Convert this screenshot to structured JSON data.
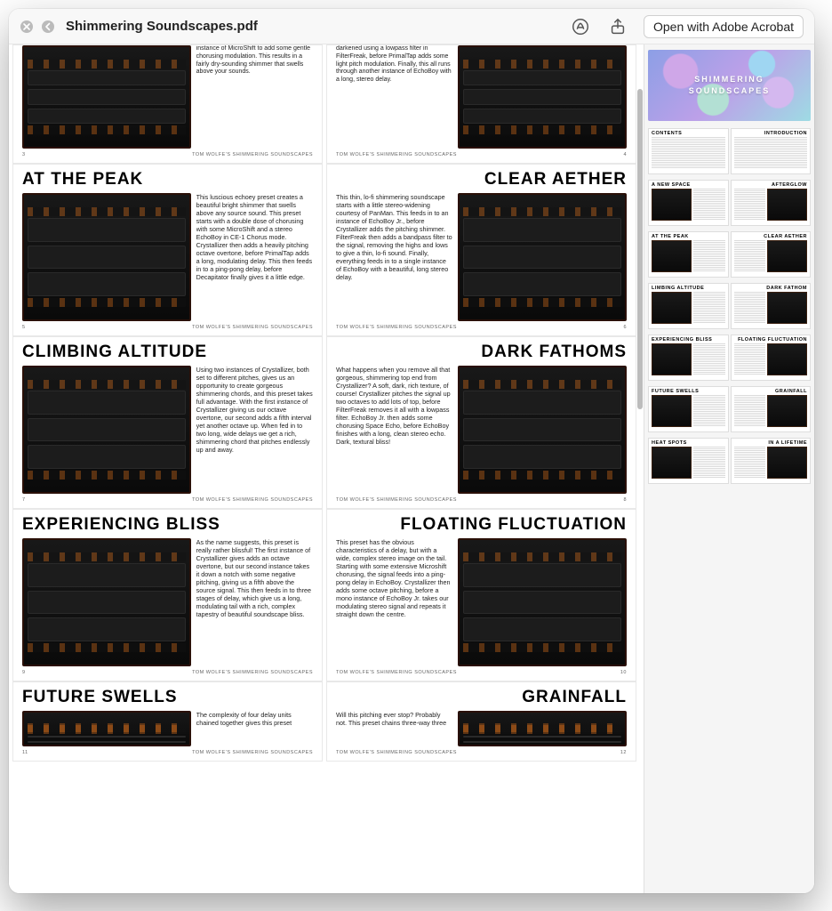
{
  "window": {
    "title": "Shimmering Soundscapes.pdf",
    "open_button": "Open with Adobe Acrobat"
  },
  "cover": {
    "line1": "SHIMMERING",
    "line2": "SOUNDSCAPES"
  },
  "footer_text": "TOM WOLFE'S SHIMMERING SOUNDSCAPES",
  "main_spreads": [
    {
      "left": {
        "page_no": "3",
        "title": "",
        "body": "instance of MicroShift to add some gentle chorusing modulation. This results in a fairly dry-sounding shimmer that swells above your sounds."
      },
      "right": {
        "page_no": "4",
        "title": "",
        "body": "darkened using a lowpass filter in FilterFreak, before PrimalTap adds some light pitch modulation. Finally, this all runs through another instance of EchoBoy with a long, stereo delay."
      }
    },
    {
      "left": {
        "page_no": "5",
        "title": "AT THE PEAK",
        "body": "This luscious echoey preset creates a beautiful bright shimmer that swells above any source sound. This preset starts with a double dose of chorusing with some MicroShift and a stereo EchoBoy in CE-1 Chorus mode. Crystallizer then adds a heavily pitching octave overtone, before PrimalTap adds a long, modulating delay. This then feeds in to a ping-pong delay, before Decapitator finally gives it a little edge."
      },
      "right": {
        "page_no": "6",
        "title": "CLEAR AETHER",
        "body": "This thin, lo-fi shimmering soundscape starts with a little stereo-widening courtesy of PanMan. This feeds in to an instance of EchoBoy Jr., before Crystallizer adds the pitching shimmer. FilterFreak then adds a bandpass filter to the signal, removing the highs and lows to give a thin, lo-fi sound. Finally, everything feeds in to a single instance of EchoBoy with a beautiful, long stereo delay."
      }
    },
    {
      "left": {
        "page_no": "7",
        "title": "CLIMBING ALTITUDE",
        "body": "Using two instances of Crystallizer, both set to different pitches, gives us an opportunity to create gorgeous shimmering chords, and this preset takes full advantage. With the first instance of Crystallizer giving us our octave overtone, our second adds a fifth interval yet another octave up. When fed in to two long, wide delays we get a rich, shimmering chord that pitches endlessly up and away."
      },
      "right": {
        "page_no": "8",
        "title": "DARK FATHOMS",
        "body": "What happens when you remove all that gorgeous, shimmering top end from Crystallizer? A soft, dark, rich texture, of course! Crystallizer pitches the signal up two octaves to add lots of top, before FilterFreak removes it all with a lowpass filter. EchoBoy Jr. then adds some chorusing Space Echo, before EchoBoy finishes with a long, clean stereo echo. Dark, textural bliss!"
      }
    },
    {
      "left": {
        "page_no": "9",
        "title": "EXPERIENCING BLISS",
        "body": "As the name suggests, this preset is really rather blissful! The first instance of Crystallizer gives adds an octave overtone, but our second instance takes it down a notch with some negative pitching, giving us a fifth above the source signal. This then feeds in to three stages of delay, which give us a long, modulating tail with a rich, complex tapestry of beautiful soundscape bliss."
      },
      "right": {
        "page_no": "10",
        "title": "FLOATING FLUCTUATION",
        "body": "This preset has the obvious characteristics of a delay, but with a wide, complex stereo image on the tail. Starting with some extensive Microshift chorusing, the signal feeds into a ping-pong delay in EchoBoy. Crystallizer then adds some octave pitching, before a mono instance of EchoBoy Jr. takes our modulating stereo signal and repeats it straight down the centre."
      }
    },
    {
      "left": {
        "page_no": "11",
        "title": "FUTURE SWELLS",
        "body": "The complexity of four delay units chained together gives this preset"
      },
      "right": {
        "page_no": "12",
        "title": "GRAINFALL",
        "body": "Will this pitching ever stop? Probably not. This preset chains three-way three"
      }
    }
  ],
  "sidebar_spreads": [
    {
      "left": {
        "title": "CONTENTS",
        "has_image": false
      },
      "right": {
        "title": "INTRODUCTION",
        "has_image": false
      }
    },
    {
      "left": {
        "title": "A NEW SPACE",
        "has_image": true
      },
      "right": {
        "title": "AFTERGLOW",
        "has_image": true
      }
    },
    {
      "left": {
        "title": "AT THE PEAK",
        "has_image": true
      },
      "right": {
        "title": "CLEAR AETHER",
        "has_image": true
      }
    },
    {
      "left": {
        "title": "LIMBING ALTITUDE",
        "has_image": true
      },
      "right": {
        "title": "DARK FATHOM",
        "has_image": true
      }
    },
    {
      "left": {
        "title": "EXPERIENCING BLISS",
        "has_image": true
      },
      "right": {
        "title": "FLOATING FLUCTUATION",
        "has_image": true
      }
    },
    {
      "left": {
        "title": "FUTURE SWELLS",
        "has_image": true
      },
      "right": {
        "title": "GRAINFALL",
        "has_image": true
      }
    },
    {
      "left": {
        "title": "HEAT SPOTS",
        "has_image": true
      },
      "right": {
        "title": "IN A LIFETIME",
        "has_image": true
      }
    }
  ]
}
